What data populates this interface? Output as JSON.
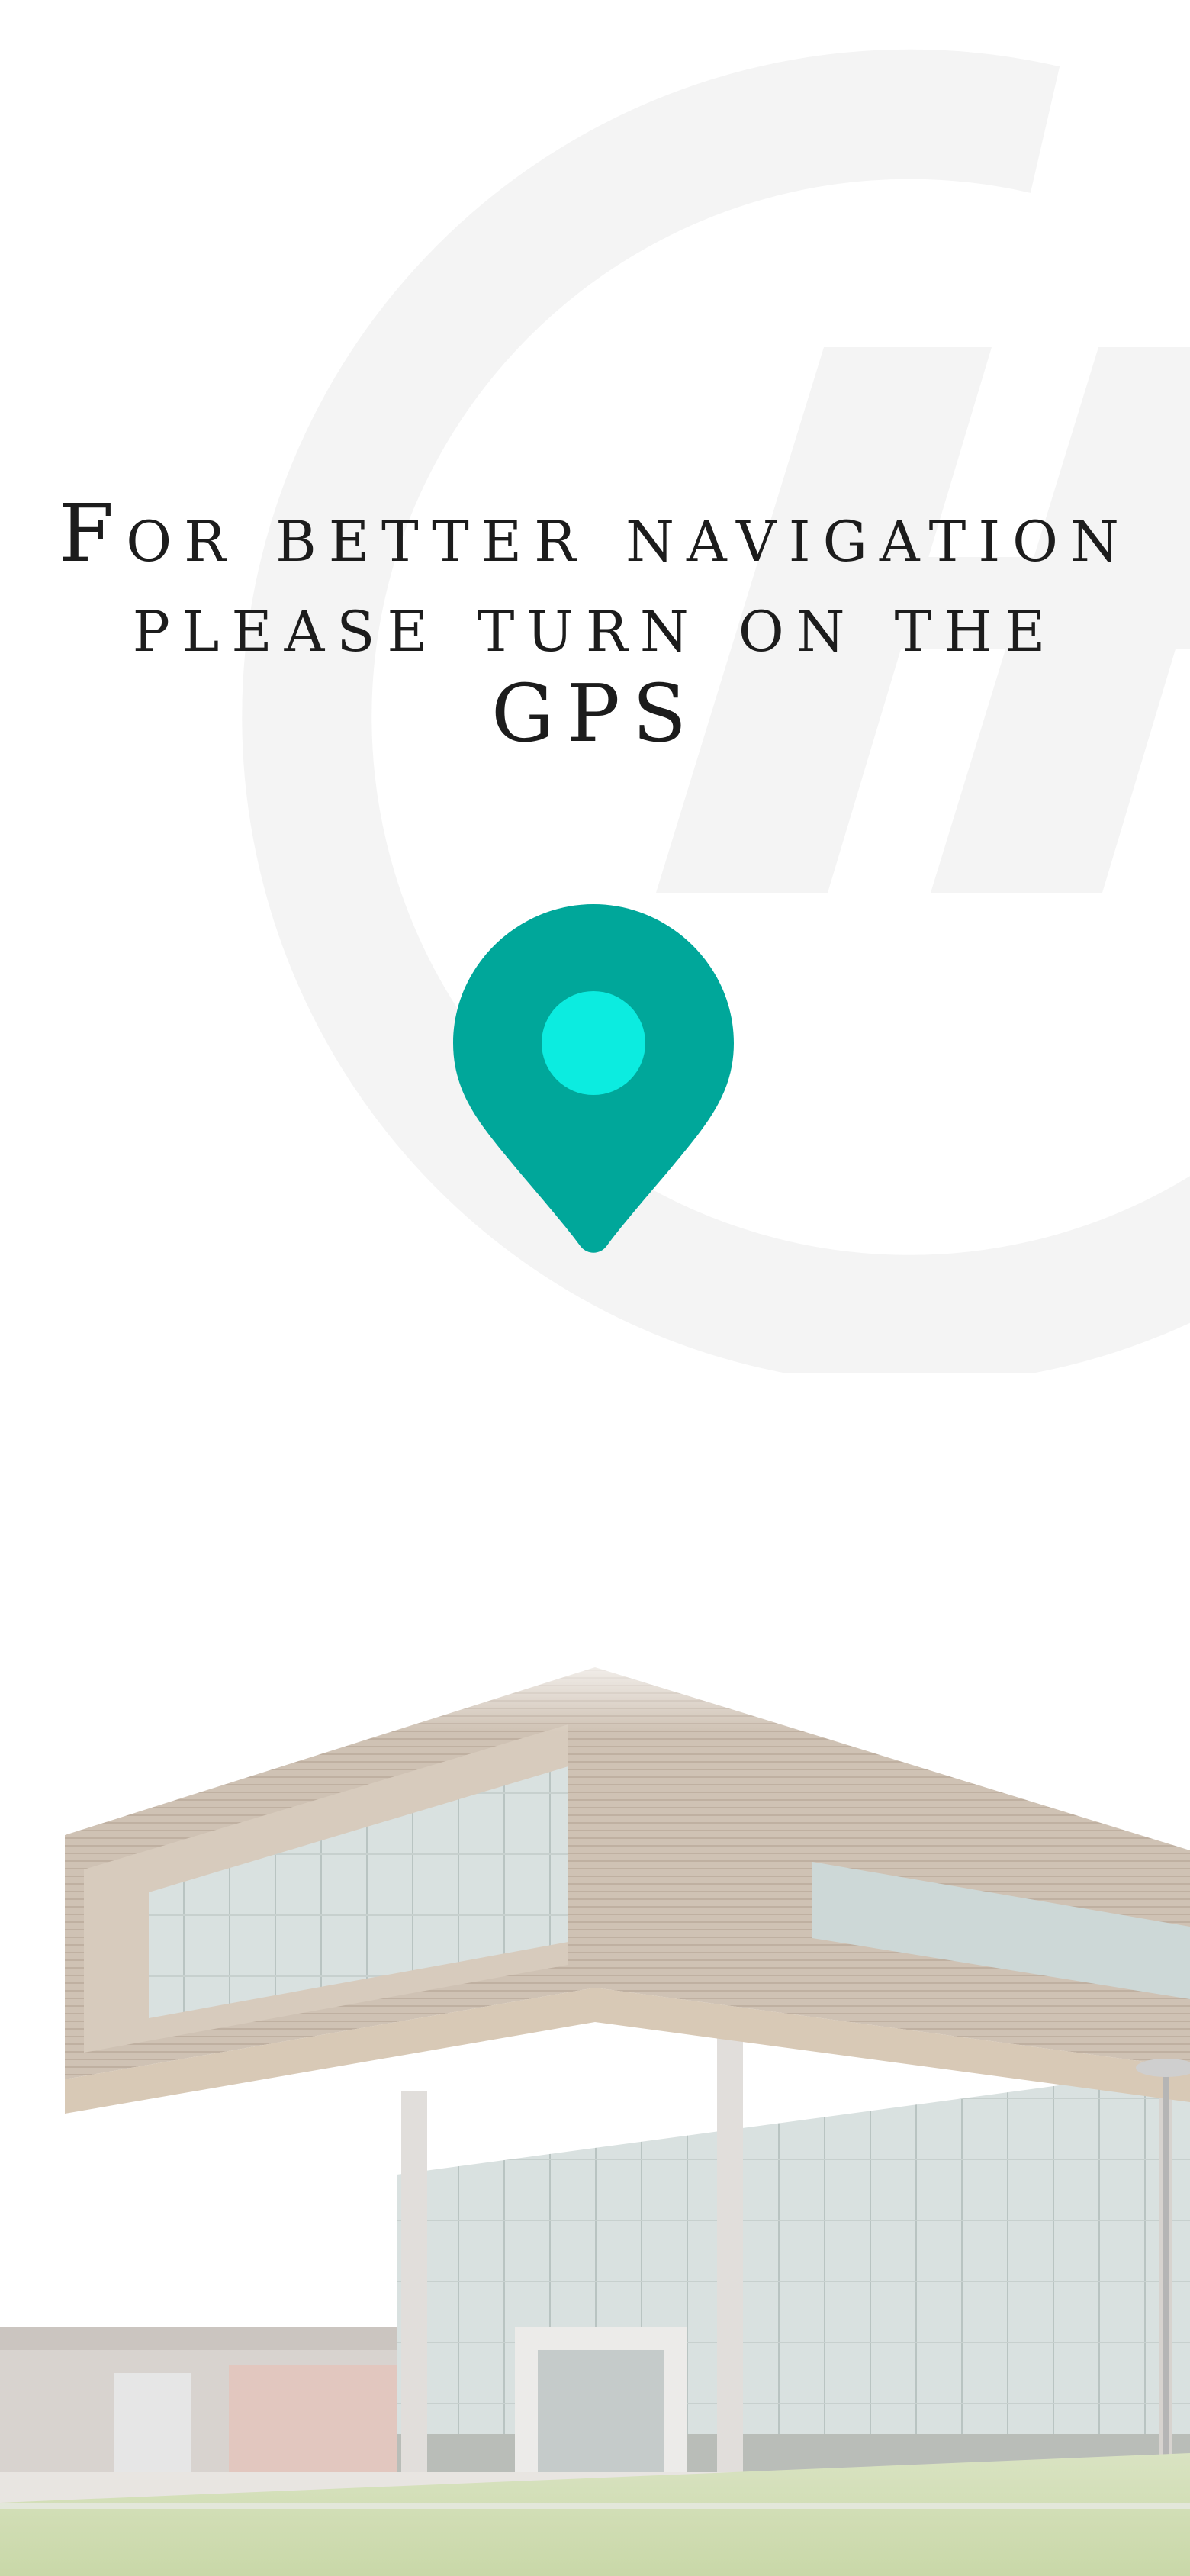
{
  "screen": {
    "message": "For better navigation please turn on the GPS"
  },
  "icons": {
    "watermark": "brand-logo-watermark",
    "pin": "location-pin-icon",
    "hero": "campus-building-illustration"
  },
  "colors": {
    "background": "#ffffff",
    "text": "#1c1c1c",
    "pin": "#00a79a",
    "pin_dot": "#0cece0",
    "watermark": "#f4f4f4"
  }
}
